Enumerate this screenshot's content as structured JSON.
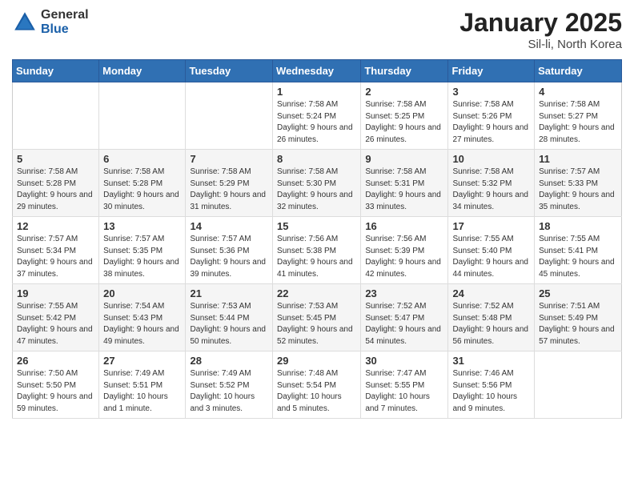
{
  "header": {
    "logo_general": "General",
    "logo_blue": "Blue",
    "month_title": "January 2025",
    "location": "Sil-li, North Korea"
  },
  "weekdays": [
    "Sunday",
    "Monday",
    "Tuesday",
    "Wednesday",
    "Thursday",
    "Friday",
    "Saturday"
  ],
  "weeks": [
    [
      {
        "day": "",
        "info": ""
      },
      {
        "day": "",
        "info": ""
      },
      {
        "day": "",
        "info": ""
      },
      {
        "day": "1",
        "info": "Sunrise: 7:58 AM\nSunset: 5:24 PM\nDaylight: 9 hours and 26 minutes."
      },
      {
        "day": "2",
        "info": "Sunrise: 7:58 AM\nSunset: 5:25 PM\nDaylight: 9 hours and 26 minutes."
      },
      {
        "day": "3",
        "info": "Sunrise: 7:58 AM\nSunset: 5:26 PM\nDaylight: 9 hours and 27 minutes."
      },
      {
        "day": "4",
        "info": "Sunrise: 7:58 AM\nSunset: 5:27 PM\nDaylight: 9 hours and 28 minutes."
      }
    ],
    [
      {
        "day": "5",
        "info": "Sunrise: 7:58 AM\nSunset: 5:28 PM\nDaylight: 9 hours and 29 minutes."
      },
      {
        "day": "6",
        "info": "Sunrise: 7:58 AM\nSunset: 5:28 PM\nDaylight: 9 hours and 30 minutes."
      },
      {
        "day": "7",
        "info": "Sunrise: 7:58 AM\nSunset: 5:29 PM\nDaylight: 9 hours and 31 minutes."
      },
      {
        "day": "8",
        "info": "Sunrise: 7:58 AM\nSunset: 5:30 PM\nDaylight: 9 hours and 32 minutes."
      },
      {
        "day": "9",
        "info": "Sunrise: 7:58 AM\nSunset: 5:31 PM\nDaylight: 9 hours and 33 minutes."
      },
      {
        "day": "10",
        "info": "Sunrise: 7:58 AM\nSunset: 5:32 PM\nDaylight: 9 hours and 34 minutes."
      },
      {
        "day": "11",
        "info": "Sunrise: 7:57 AM\nSunset: 5:33 PM\nDaylight: 9 hours and 35 minutes."
      }
    ],
    [
      {
        "day": "12",
        "info": "Sunrise: 7:57 AM\nSunset: 5:34 PM\nDaylight: 9 hours and 37 minutes."
      },
      {
        "day": "13",
        "info": "Sunrise: 7:57 AM\nSunset: 5:35 PM\nDaylight: 9 hours and 38 minutes."
      },
      {
        "day": "14",
        "info": "Sunrise: 7:57 AM\nSunset: 5:36 PM\nDaylight: 9 hours and 39 minutes."
      },
      {
        "day": "15",
        "info": "Sunrise: 7:56 AM\nSunset: 5:38 PM\nDaylight: 9 hours and 41 minutes."
      },
      {
        "day": "16",
        "info": "Sunrise: 7:56 AM\nSunset: 5:39 PM\nDaylight: 9 hours and 42 minutes."
      },
      {
        "day": "17",
        "info": "Sunrise: 7:55 AM\nSunset: 5:40 PM\nDaylight: 9 hours and 44 minutes."
      },
      {
        "day": "18",
        "info": "Sunrise: 7:55 AM\nSunset: 5:41 PM\nDaylight: 9 hours and 45 minutes."
      }
    ],
    [
      {
        "day": "19",
        "info": "Sunrise: 7:55 AM\nSunset: 5:42 PM\nDaylight: 9 hours and 47 minutes."
      },
      {
        "day": "20",
        "info": "Sunrise: 7:54 AM\nSunset: 5:43 PM\nDaylight: 9 hours and 49 minutes."
      },
      {
        "day": "21",
        "info": "Sunrise: 7:53 AM\nSunset: 5:44 PM\nDaylight: 9 hours and 50 minutes."
      },
      {
        "day": "22",
        "info": "Sunrise: 7:53 AM\nSunset: 5:45 PM\nDaylight: 9 hours and 52 minutes."
      },
      {
        "day": "23",
        "info": "Sunrise: 7:52 AM\nSunset: 5:47 PM\nDaylight: 9 hours and 54 minutes."
      },
      {
        "day": "24",
        "info": "Sunrise: 7:52 AM\nSunset: 5:48 PM\nDaylight: 9 hours and 56 minutes."
      },
      {
        "day": "25",
        "info": "Sunrise: 7:51 AM\nSunset: 5:49 PM\nDaylight: 9 hours and 57 minutes."
      }
    ],
    [
      {
        "day": "26",
        "info": "Sunrise: 7:50 AM\nSunset: 5:50 PM\nDaylight: 9 hours and 59 minutes."
      },
      {
        "day": "27",
        "info": "Sunrise: 7:49 AM\nSunset: 5:51 PM\nDaylight: 10 hours and 1 minute."
      },
      {
        "day": "28",
        "info": "Sunrise: 7:49 AM\nSunset: 5:52 PM\nDaylight: 10 hours and 3 minutes."
      },
      {
        "day": "29",
        "info": "Sunrise: 7:48 AM\nSunset: 5:54 PM\nDaylight: 10 hours and 5 minutes."
      },
      {
        "day": "30",
        "info": "Sunrise: 7:47 AM\nSunset: 5:55 PM\nDaylight: 10 hours and 7 minutes."
      },
      {
        "day": "31",
        "info": "Sunrise: 7:46 AM\nSunset: 5:56 PM\nDaylight: 10 hours and 9 minutes."
      },
      {
        "day": "",
        "info": ""
      }
    ]
  ]
}
